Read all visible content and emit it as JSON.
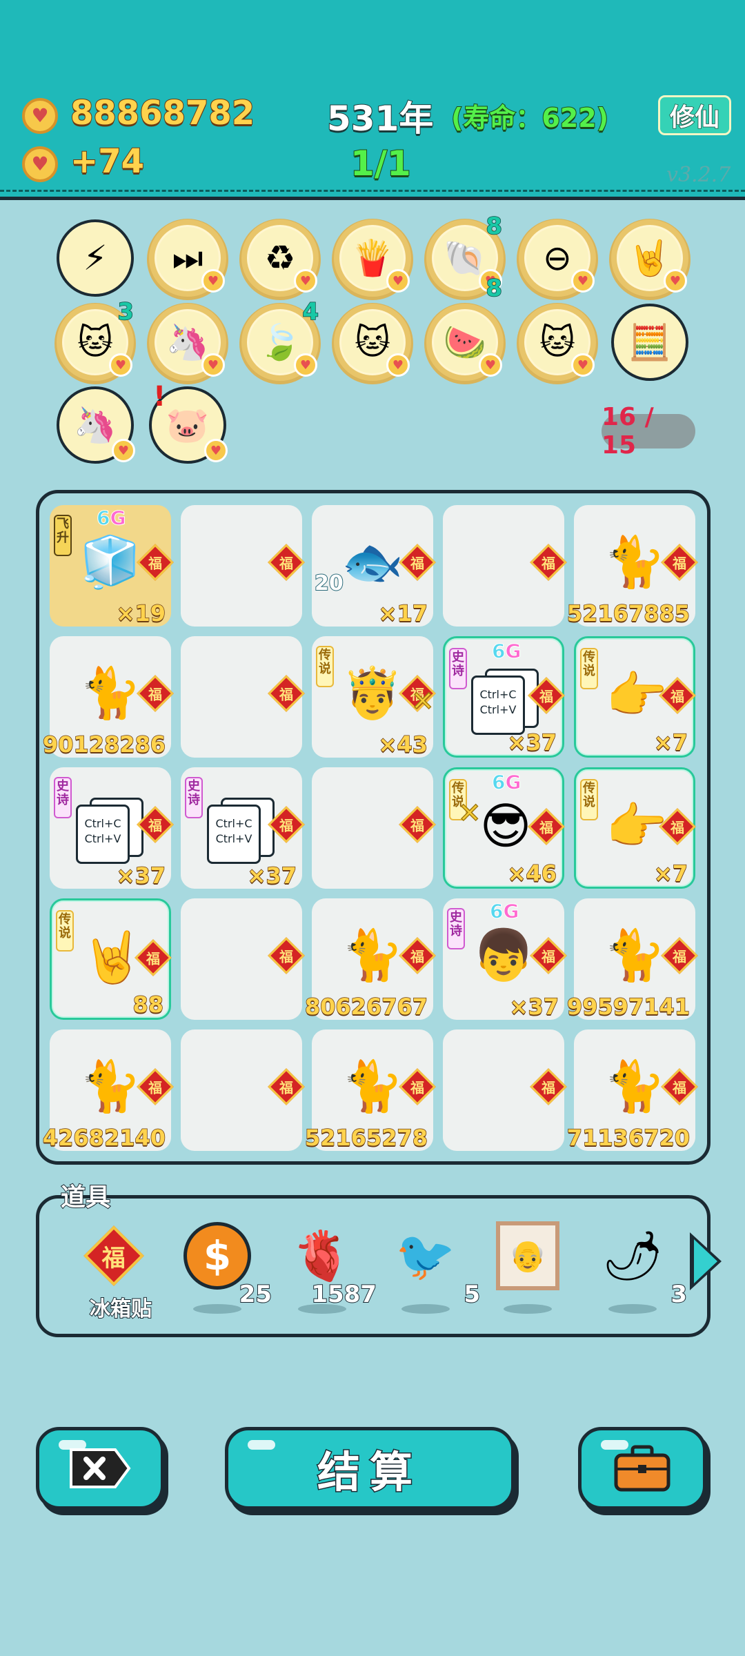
{
  "header": {
    "coins": "88868782",
    "coin_delta": "+74",
    "year": "531年",
    "lifespan": "(寿命：622)",
    "progress": "1/1",
    "cultivate_label": "修仙",
    "version": "v3.2.7"
  },
  "relics": {
    "row1": [
      {
        "icon": "lightning-icon",
        "glyph": "⚡"
      },
      {
        "icon": "skip-end-icon",
        "glyph": "⏭"
      },
      {
        "icon": "recycle-icon",
        "glyph": "♻"
      },
      {
        "icon": "fries-icon",
        "glyph": "🍟"
      },
      {
        "icon": "shell-icon",
        "glyph": "🐚",
        "count_top": "8",
        "count_bottom": "8"
      },
      {
        "icon": "minus-circle-icon",
        "glyph": "⊖"
      },
      {
        "icon": "rock-hand-icon",
        "glyph": "🤘"
      }
    ],
    "row2": [
      {
        "icon": "cat-card-icon",
        "glyph": "🐱",
        "count": "3"
      },
      {
        "icon": "unicorn-icon",
        "glyph": "🦄"
      },
      {
        "icon": "leaf-icon",
        "glyph": "🍃",
        "count": "4"
      },
      {
        "icon": "twin-cats-icon",
        "glyph": "🐱"
      },
      {
        "icon": "fruit-basket-icon",
        "glyph": "🍉"
      },
      {
        "icon": "twin-cats-icon",
        "glyph": "🐱"
      },
      {
        "icon": "math-head-icon",
        "glyph": "🧮"
      }
    ],
    "row3": [
      {
        "icon": "unicorn-icon",
        "glyph": "🦄"
      },
      {
        "icon": "piggy-bank-icon",
        "glyph": "🐷"
      }
    ],
    "counter": "16 / 15"
  },
  "board": {
    "cells": [
      {
        "tag": "飞升",
        "tag_type": "asc",
        "sixg": true,
        "icon": "fridge-icon",
        "glyph": "🧊",
        "count": "×19",
        "gold": true
      },
      {
        "icon": "",
        "glyph": "",
        "count": ""
      },
      {
        "icon": "fish-icon",
        "glyph": "🐟",
        "side": "20",
        "count": "×17"
      },
      {
        "icon": "",
        "glyph": "",
        "count": ""
      },
      {
        "icon": "cat-icon",
        "glyph": "🐈",
        "count": "52167885"
      },
      {
        "icon": "tabby-cat-icon",
        "glyph": "🐈",
        "count": "90128286"
      },
      {
        "icon": "",
        "glyph": "",
        "count": ""
      },
      {
        "tag": "传说",
        "tag_type": "leg",
        "icon": "king-face-icon",
        "glyph": "🤴",
        "count": "×43"
      },
      {
        "tag": "史诗",
        "tag_type": "epic",
        "sixg": true,
        "icon": "ctrl-cv-icon",
        "ctrl": true,
        "rare": true,
        "count": "×37"
      },
      {
        "tag": "传说",
        "tag_type": "leg",
        "icon": "pointing-hand-icon",
        "glyph": "👉",
        "rare": true,
        "count": "×7"
      },
      {
        "tag": "史诗",
        "tag_type": "epic",
        "icon": "ctrl-cv-icon",
        "ctrl": true,
        "count": "×37"
      },
      {
        "tag": "史诗",
        "tag_type": "epic",
        "icon": "ctrl-cv-icon",
        "ctrl": true,
        "count": "×37"
      },
      {
        "icon": "",
        "glyph": "",
        "count": ""
      },
      {
        "tag": "传说",
        "tag_type": "leg",
        "sixg": true,
        "icon": "sunglasses-man-icon",
        "glyph": "😎",
        "rare": true,
        "count": "×46"
      },
      {
        "tag": "传说",
        "tag_type": "leg",
        "icon": "pointing-hand-icon",
        "glyph": "👉",
        "rare": true,
        "count": "×7"
      },
      {
        "tag": "传说",
        "tag_type": "leg",
        "icon": "rock-hand-icon",
        "glyph": "🤘",
        "rare": true,
        "count": "88"
      },
      {
        "icon": "",
        "glyph": "",
        "count": ""
      },
      {
        "icon": "cat-icon",
        "glyph": "🐈",
        "count": "80626767"
      },
      {
        "tag": "史诗",
        "tag_type": "epic",
        "sixg": true,
        "icon": "red-cap-boy-icon",
        "glyph": "👦",
        "count": "×37"
      },
      {
        "icon": "cat-icon",
        "glyph": "🐈",
        "count": "99597141"
      },
      {
        "icon": "cat-icon",
        "glyph": "🐈",
        "count": "42682140"
      },
      {
        "icon": "",
        "glyph": "",
        "count": ""
      },
      {
        "icon": "cat-icon",
        "glyph": "🐈",
        "count": "52165278"
      },
      {
        "icon": "",
        "glyph": "",
        "count": ""
      },
      {
        "icon": "cat-icon",
        "glyph": "🐈",
        "count": "71136720"
      }
    ],
    "fu_char": "福",
    "sixg_label": "6G",
    "ctrl_c": "Ctrl+C",
    "ctrl_v": "Ctrl+V"
  },
  "tools": {
    "title": "道具",
    "items": [
      {
        "icon": "fu-sticker-icon",
        "glyph": "福",
        "label": "冰箱贴",
        "count": ""
      },
      {
        "icon": "dollar-coin-icon",
        "glyph": "$",
        "count": "25"
      },
      {
        "icon": "liver-icon",
        "glyph": "🫀",
        "count": "1587"
      },
      {
        "icon": "white-bird-icon",
        "glyph": "🐦",
        "count": "5"
      },
      {
        "icon": "portrait-frame-icon",
        "glyph": "🖼",
        "count": ""
      },
      {
        "icon": "chili-pepper-icon",
        "glyph": "🌶",
        "count": "3"
      }
    ]
  },
  "footer": {
    "settle_label": "结算"
  },
  "colors": {
    "header_bg": "#1fb9b9",
    "page_bg": "#a6d8de",
    "gold_text": "#ffd34d",
    "rare_border": "#28c99a",
    "button_bg": "#26c7c7"
  }
}
